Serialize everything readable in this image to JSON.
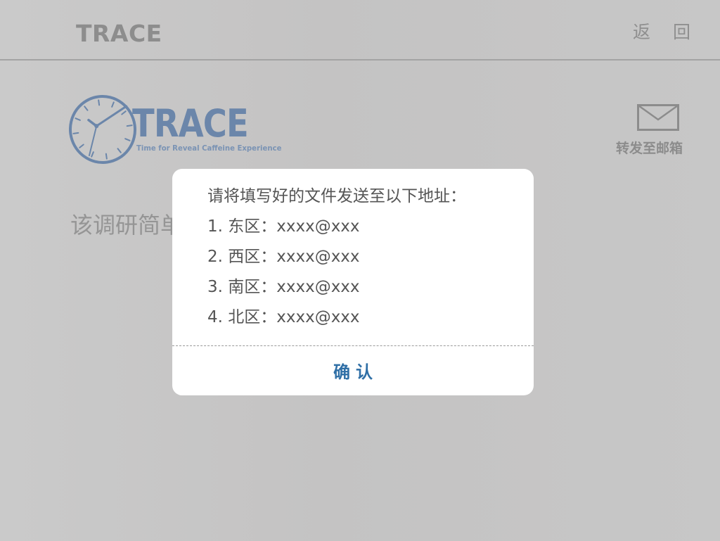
{
  "header": {
    "title": "TRACE",
    "back_label": "返 回"
  },
  "logo": {
    "wordmark": "TRACE",
    "tagline": "Time for Reveal Caffeine Experience",
    "color": "#6b86aa"
  },
  "forward": {
    "label": "转发至邮箱",
    "icon": "envelope-icon"
  },
  "main": {
    "survey_text": "该调研简单"
  },
  "dialog": {
    "title": "请将填写好的文件发送至以下地址：",
    "addresses": [
      "1. 东区：xxxx@xxx",
      "2. 西区：xxxx@xxx",
      "3. 南区：xxxx@xxx",
      "4. 北区：xxxx@xxx"
    ],
    "confirm_label": "确认"
  },
  "colors": {
    "accent": "#2f6fa6",
    "background": "#c6c5c5",
    "dialog": "#ffffff"
  }
}
